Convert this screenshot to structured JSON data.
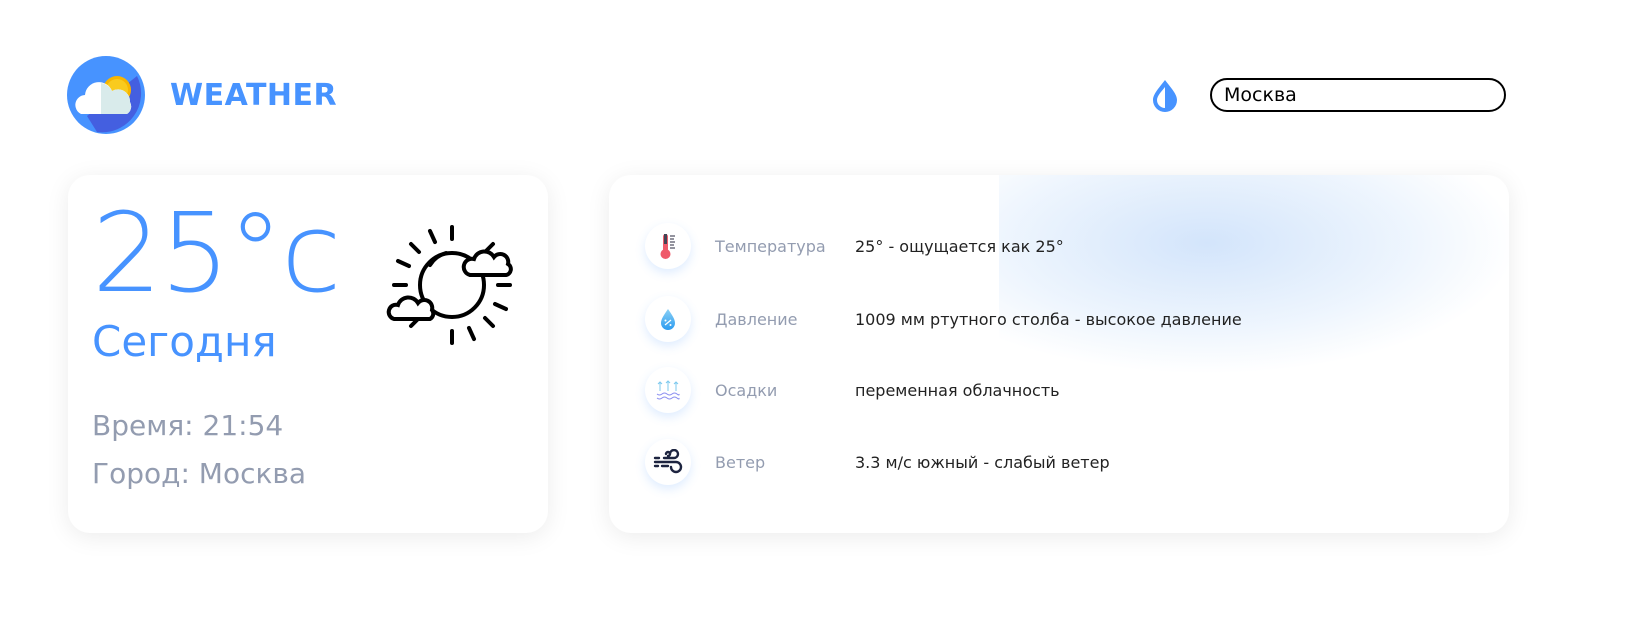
{
  "header": {
    "brand": "WEATHER",
    "search": {
      "value": "Москва"
    }
  },
  "current": {
    "temperature": "25°c",
    "day": "Сегодня",
    "time": "Время: 21:54",
    "city": "Город: Москва"
  },
  "details": [
    {
      "icon": "thermometer-icon",
      "label": "Температура",
      "value": "25° - ощущается как 25°"
    },
    {
      "icon": "water-drop-icon",
      "label": "Давление",
      "value": "1009 мм ртутного столба - высокое давление"
    },
    {
      "icon": "evaporation-icon",
      "label": "Осадки",
      "value": "переменная облачность"
    },
    {
      "icon": "wind-icon",
      "label": "Ветер",
      "value": "3.3 м/с южный - слабый ветер"
    }
  ],
  "colors": {
    "accent": "#4793ff",
    "muted": "#939cb0"
  }
}
